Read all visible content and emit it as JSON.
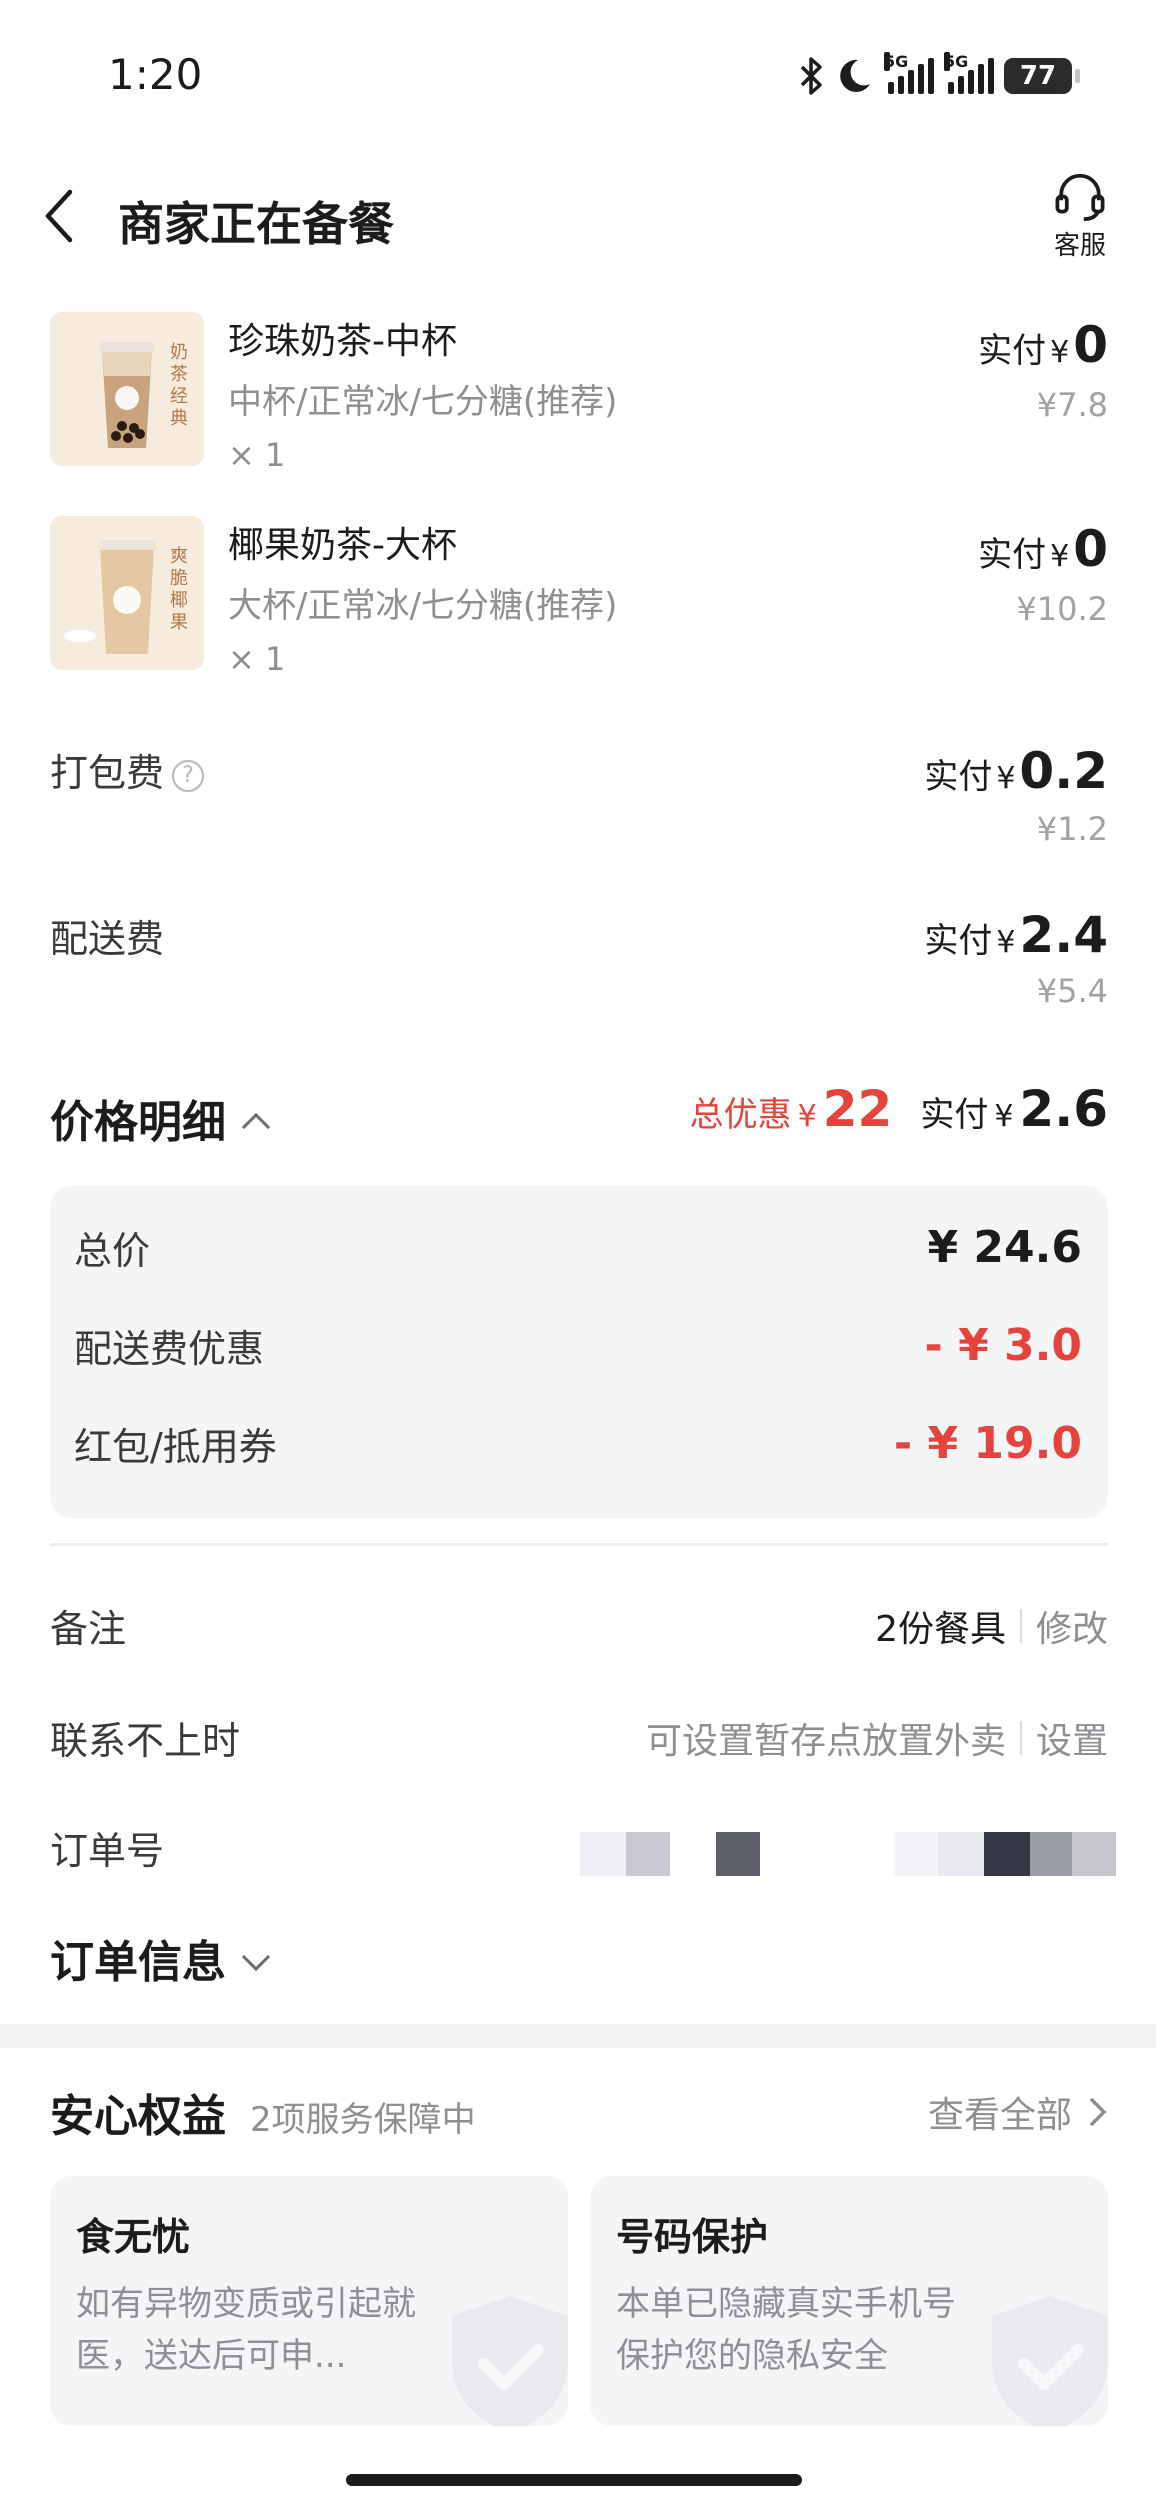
{
  "status_bar": {
    "time": "1:20",
    "battery": "77",
    "sim1_tag": "5G",
    "sim2_tag": "5G"
  },
  "header": {
    "title": "商家正在备餐",
    "service_label": "客服"
  },
  "items": [
    {
      "name": "珍珠奶茶-中杯",
      "spec": "中杯/正常冰/七分糖(推荐)",
      "qty": "× 1",
      "pay_label": "实付",
      "currency": "¥",
      "pay_value": "0",
      "original": "¥7.8",
      "cup_text": "奶茶经典"
    },
    {
      "name": "椰果奶茶-大杯",
      "spec": "大杯/正常冰/七分糖(推荐)",
      "qty": "× 1",
      "pay_label": "实付",
      "currency": "¥",
      "pay_value": "0",
      "original": "¥10.2",
      "cup_text": "爽脆椰果"
    }
  ],
  "fees": [
    {
      "label": "打包费",
      "pay_label": "实付",
      "currency": "¥",
      "pay_value": "0.2",
      "original": "¥1.2",
      "help": "?"
    },
    {
      "label": "配送费",
      "pay_label": "实付",
      "currency": "¥",
      "pay_value": "2.4",
      "original": "¥5.4"
    }
  ],
  "price_detail": {
    "title": "价格明细",
    "total_discount_label": "总优惠",
    "total_discount_currency": "¥",
    "total_discount_value": "22",
    "pay_label": "实付",
    "pay_currency": "¥",
    "pay_value": "2.6",
    "rows": [
      {
        "label": "总价",
        "value": "¥ 24.6"
      },
      {
        "label": "配送费优惠",
        "value": "- ¥ 3.0"
      },
      {
        "label": "红包/抵用券",
        "value": "- ¥ 19.0"
      }
    ]
  },
  "info": {
    "note_label": "备注",
    "note_value": "2份餐具",
    "note_action": "修改",
    "unreachable_label": "联系不上时",
    "unreachable_value": "可设置暂存点放置外卖",
    "unreachable_action": "设置",
    "order_no_label": "订单号",
    "order_info_title": "订单信息"
  },
  "benefits": {
    "title": "安心权益",
    "subtitle": "2项服务保障中",
    "view_all": "查看全部",
    "cards": [
      {
        "title": "食无忧",
        "text": "如有异物变质或引起就医，送达后可申..."
      },
      {
        "title": "号码保护",
        "text": "本单已隐藏真实手机号保护您的隐私安全"
      }
    ]
  },
  "colors": {
    "accent_red": "#e5443c",
    "text_primary": "#1c1c1e",
    "text_secondary": "#8e8e93",
    "panel_bg": "#f4f5f7"
  }
}
